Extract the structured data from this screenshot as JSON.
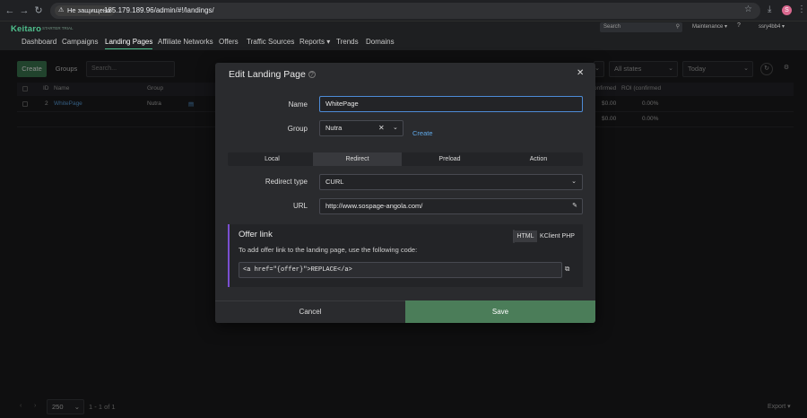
{
  "browser": {
    "security_label": "Не защищено",
    "url": "185.179.189.96/admin/#!/landings/",
    "profile_initial": "S",
    "icons": [
      "back-icon",
      "forward-icon",
      "reload-icon",
      "star-icon",
      "download-icon",
      "menu-icon"
    ]
  },
  "header": {
    "logo": "Keitaro",
    "logo_sub": "STARTER TRIAL",
    "search_placeholder": "Search",
    "maintenance": "Maintenance ▾",
    "help": "?",
    "user": "ssry4bb4 ▾",
    "nav": [
      "Dashboard",
      "Campaigns",
      "Landing Pages",
      "Affiliate Networks",
      "Offers",
      "Traffic Sources",
      "Reports ▾",
      "Trends",
      "Domains"
    ],
    "active_nav": "Landing Pages"
  },
  "list": {
    "create": "Create",
    "groups": "Groups",
    "search_placeholder": "Search...",
    "states_select": "All states",
    "date_select": "Today",
    "columns": [
      "ID",
      "Name",
      "Group",
      "onfirmed",
      "ROI (confirmed"
    ],
    "rows": [
      {
        "id": "2",
        "name": "WhitePage",
        "group": "Nutra",
        "confirmed": "$0.00",
        "roi": "0.00%"
      }
    ],
    "totals": {
      "confirmed": "$0.00",
      "roi": "0.00%"
    }
  },
  "footer": {
    "per_page": "250",
    "page_info": "1 - 1 of 1",
    "export": "Export ▾"
  },
  "modal": {
    "title": "Edit Landing Page",
    "name_label": "Name",
    "name_value": "WhitePage",
    "group_label": "Group",
    "group_value": "Nutra",
    "group_create": "Create",
    "tabs": [
      "Local",
      "Redirect",
      "Preload",
      "Action"
    ],
    "active_tab": "Redirect",
    "redirect_type_label": "Redirect type",
    "redirect_type_value": "CURL",
    "url_label": "URL",
    "url_value": "http://www.sospage-angola.com/",
    "offer_title": "Offer link",
    "offer_desc": "To add offer link to the landing page, use the following code:",
    "offer_toggle": [
      "HTML",
      "KClient PHP"
    ],
    "offer_toggle_active": "HTML",
    "offer_code": "<a href=\"{offer}\">REPLACE</a>",
    "cancel": "Cancel",
    "save": "Save"
  }
}
